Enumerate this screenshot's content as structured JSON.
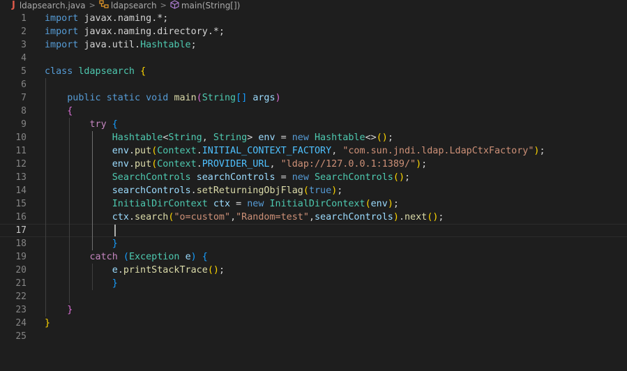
{
  "breadcrumb": {
    "file_icon_glyph": "J",
    "file": "ldapsearch.java",
    "class": "ldapsearch",
    "method": "main(String[])",
    "separator": ">",
    "icons": [
      "java-file-icon",
      "class-icon",
      "method-cube-icon"
    ]
  },
  "editor": {
    "current_line": 17,
    "lines": [
      {
        "n": "1",
        "text": "import javax.naming.*;"
      },
      {
        "n": "2",
        "text": "import javax.naming.directory.*;"
      },
      {
        "n": "3",
        "text": "import java.util.Hashtable;"
      },
      {
        "n": "4",
        "text": ""
      },
      {
        "n": "5",
        "text": "class ldapsearch {"
      },
      {
        "n": "6",
        "text": ""
      },
      {
        "n": "7",
        "text": "    public static void main(String[] args)"
      },
      {
        "n": "8",
        "text": "    {"
      },
      {
        "n": "9",
        "text": "        try {"
      },
      {
        "n": "10",
        "text": "            Hashtable<String, String> env = new Hashtable<>();"
      },
      {
        "n": "11",
        "text": "            env.put(Context.INITIAL_CONTEXT_FACTORY, \"com.sun.jndi.ldap.LdapCtxFactory\");"
      },
      {
        "n": "12",
        "text": "            env.put(Context.PROVIDER_URL, \"ldap://127.0.0.1:1389/\");"
      },
      {
        "n": "13",
        "text": "            SearchControls searchControls = new SearchControls();"
      },
      {
        "n": "14",
        "text": "            searchControls.setReturningObjFlag(true);"
      },
      {
        "n": "15",
        "text": "            InitialDirContext ctx = new InitialDirContext(env);"
      },
      {
        "n": "16",
        "text": "            ctx.search(\"o=custom\",\"Random=test\",searchControls).next();"
      },
      {
        "n": "17",
        "text": ""
      },
      {
        "n": "18",
        "text": "            }"
      },
      {
        "n": "19",
        "text": "        catch (Exception e) {"
      },
      {
        "n": "20",
        "text": "            e.printStackTrace();"
      },
      {
        "n": "21",
        "text": "            }"
      },
      {
        "n": "22",
        "text": ""
      },
      {
        "n": "23",
        "text": "    }"
      },
      {
        "n": "24",
        "text": "}"
      },
      {
        "n": "25",
        "text": ""
      }
    ]
  },
  "colors": {
    "background": "#1e1e1e",
    "keyword": "#569cd6",
    "control_keyword": "#c586c0",
    "type": "#4ec9b0",
    "function": "#dcdcaa",
    "variable": "#9cdcfe",
    "string": "#ce9178",
    "constant": "#4fc1ff",
    "line_number": "#858585"
  }
}
